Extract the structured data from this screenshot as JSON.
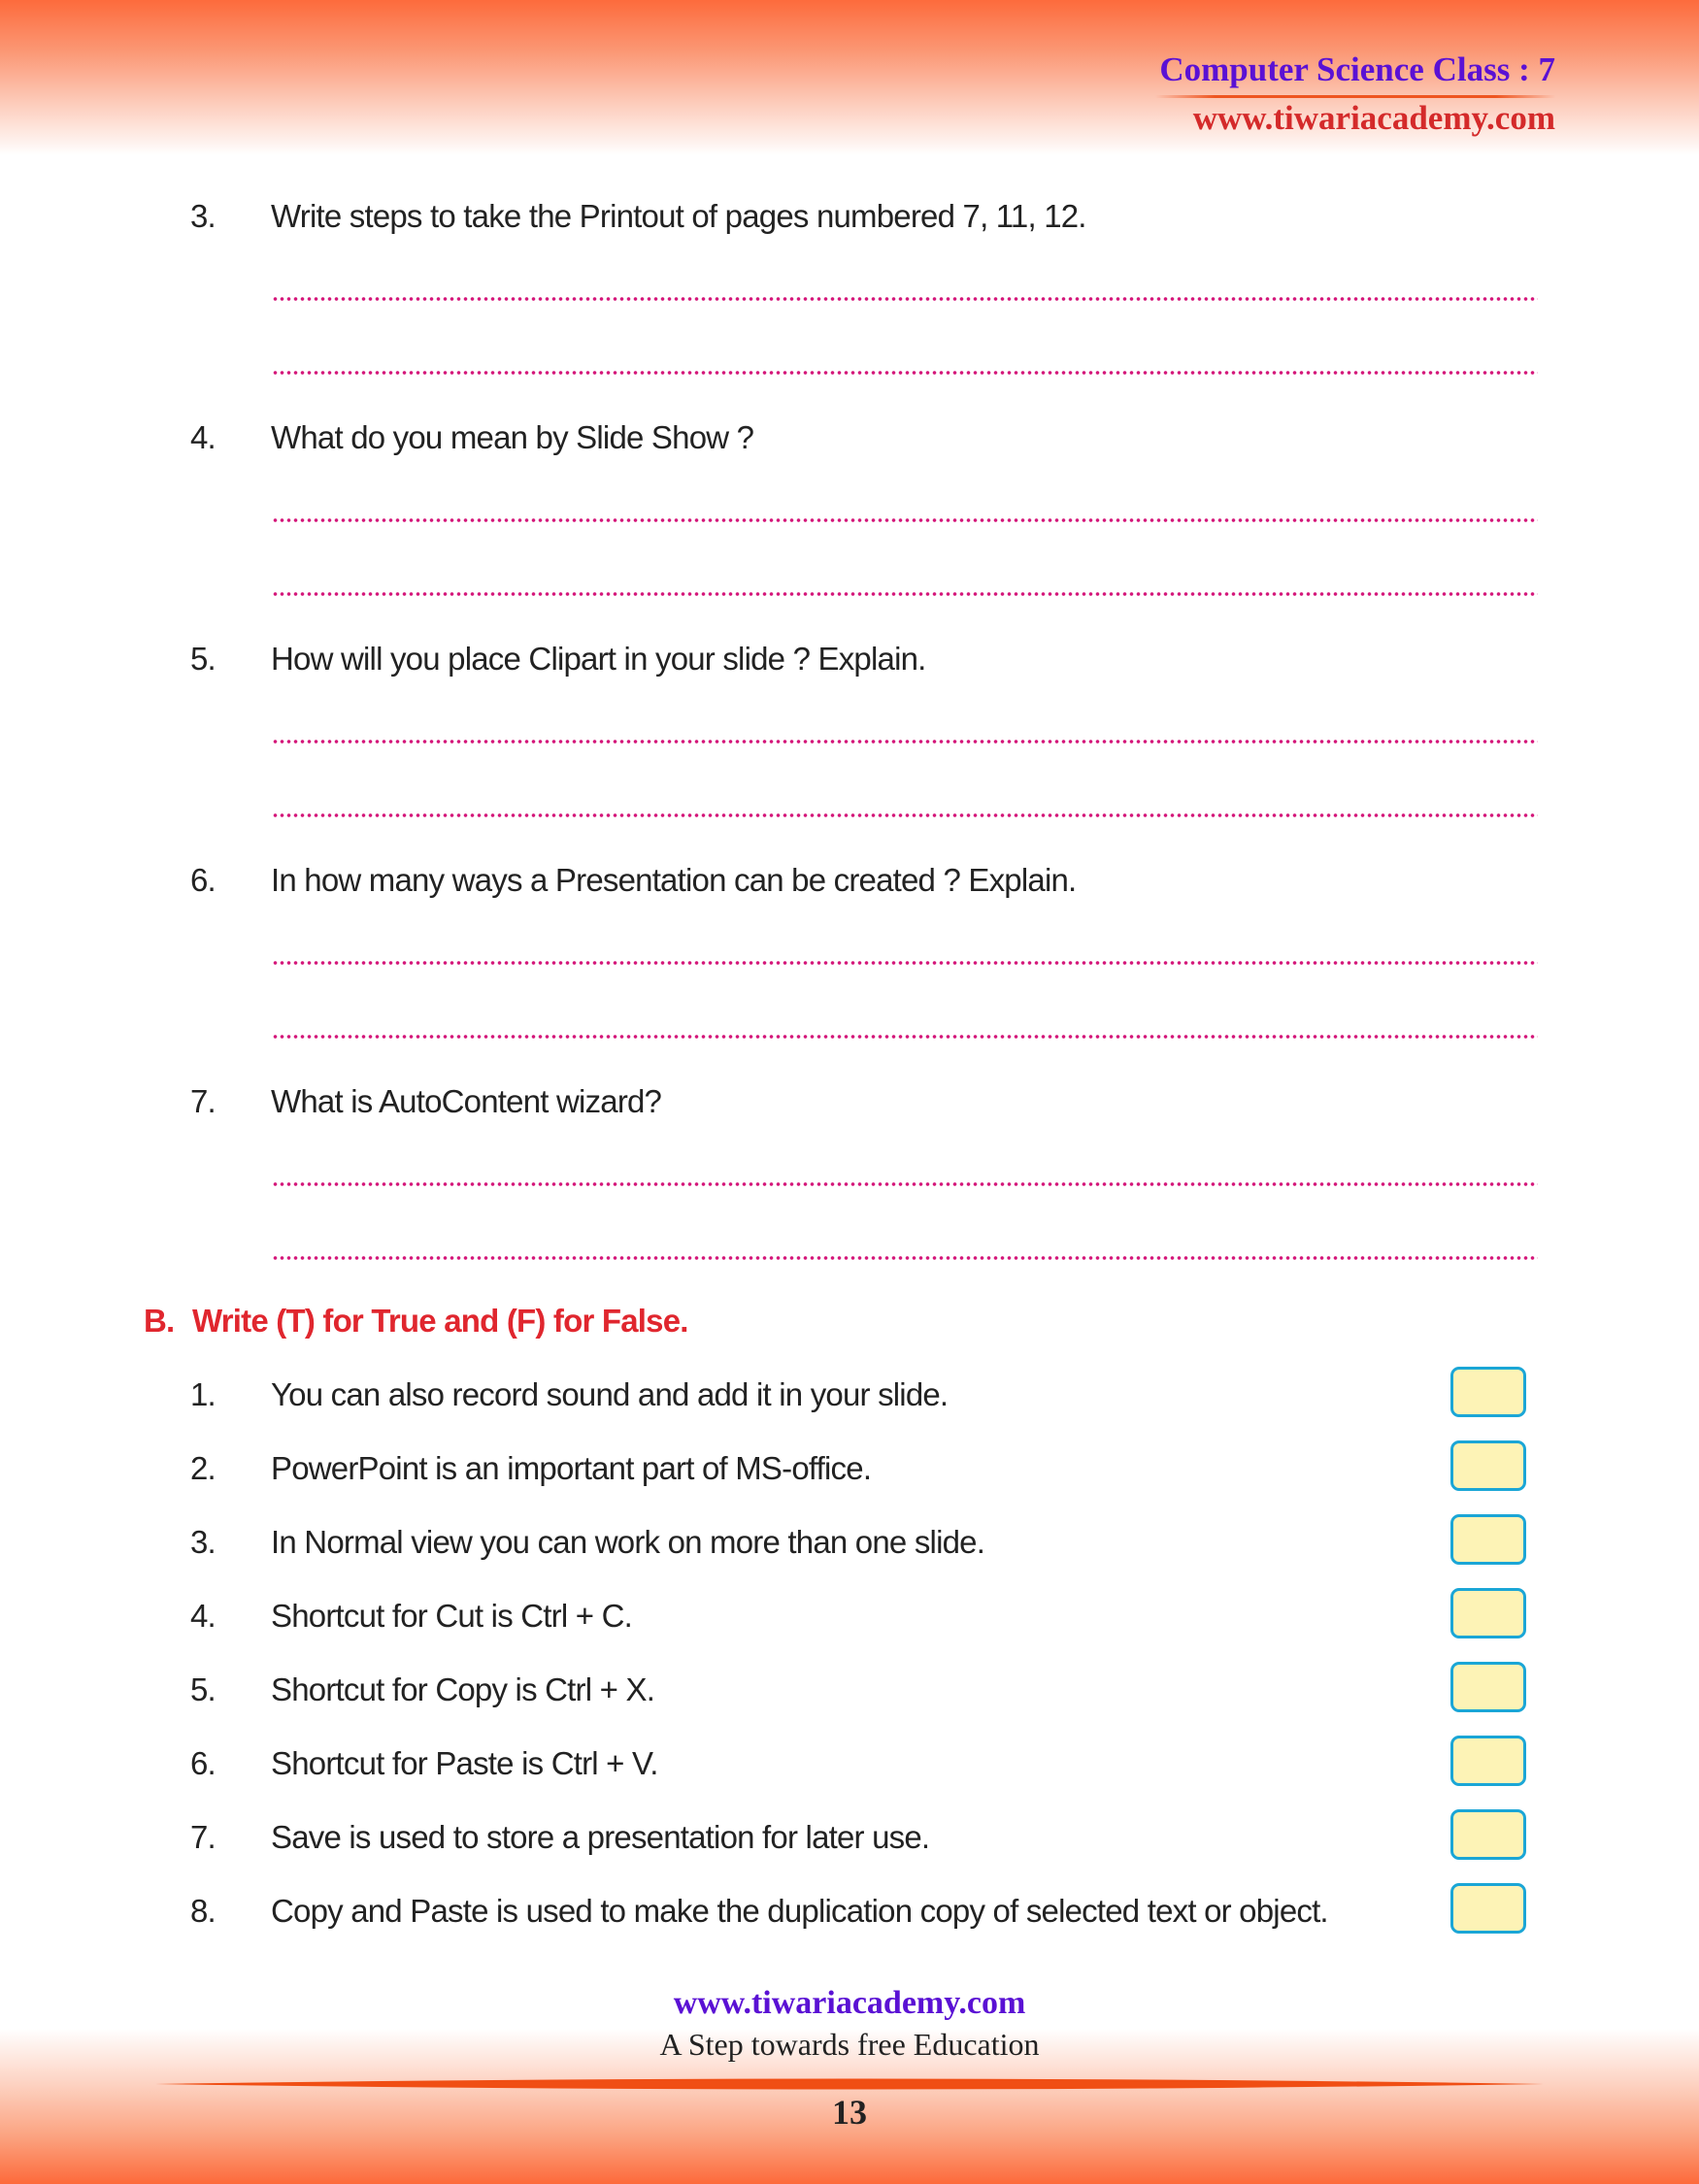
{
  "header": {
    "title": "Computer Science Class : 7",
    "url": "www.tiwariacademy.com"
  },
  "questions": [
    {
      "number": "3.",
      "text": "Write steps to take the Printout of pages numbered 7, 11, 12."
    },
    {
      "number": "4.",
      "text": "What do you mean by Slide Show ?"
    },
    {
      "number": "5.",
      "text": "How will you place Clipart in your slide ? Explain."
    },
    {
      "number": "6.",
      "text": "In how many ways a Presentation can be created ? Explain."
    },
    {
      "number": "7.",
      "text": "What is AutoContent wizard?"
    }
  ],
  "section_b": {
    "letter": "B.",
    "heading": "Write (T) for True and (F) for False.",
    "items": [
      {
        "number": "1.",
        "text": "You can also record sound and add it in your slide.",
        "answer": ""
      },
      {
        "number": "2.",
        "text": "PowerPoint is an important part of MS-office.",
        "answer": ""
      },
      {
        "number": "3.",
        "text": "In Normal view you can work on more than one slide.",
        "answer": ""
      },
      {
        "number": "4.",
        "text": "Shortcut for Cut is Ctrl + C.",
        "answer": ""
      },
      {
        "number": "5.",
        "text": "Shortcut for Copy is Ctrl + X.",
        "answer": ""
      },
      {
        "number": "6.",
        "text": "Shortcut for Paste is Ctrl + V.",
        "answer": ""
      },
      {
        "number": "7.",
        "text": "Save is used to store a presentation for later use.",
        "answer": ""
      },
      {
        "number": "8.",
        "text": "Copy and Paste is used to make the duplication copy of selected text or object.",
        "answer": ""
      }
    ]
  },
  "footer": {
    "url": "www.tiwariacademy.com",
    "tagline": "A Step towards free Education",
    "page_number": "13"
  },
  "colors": {
    "brand_purple": "#5a11d4",
    "brand_red": "#d42a2a",
    "section_heading": "#e0262e",
    "dotted_line": "#d4177a",
    "box_fill": "#fdf3b6",
    "box_border": "#1ba6d6",
    "band_orange": "#fd6b3c"
  }
}
